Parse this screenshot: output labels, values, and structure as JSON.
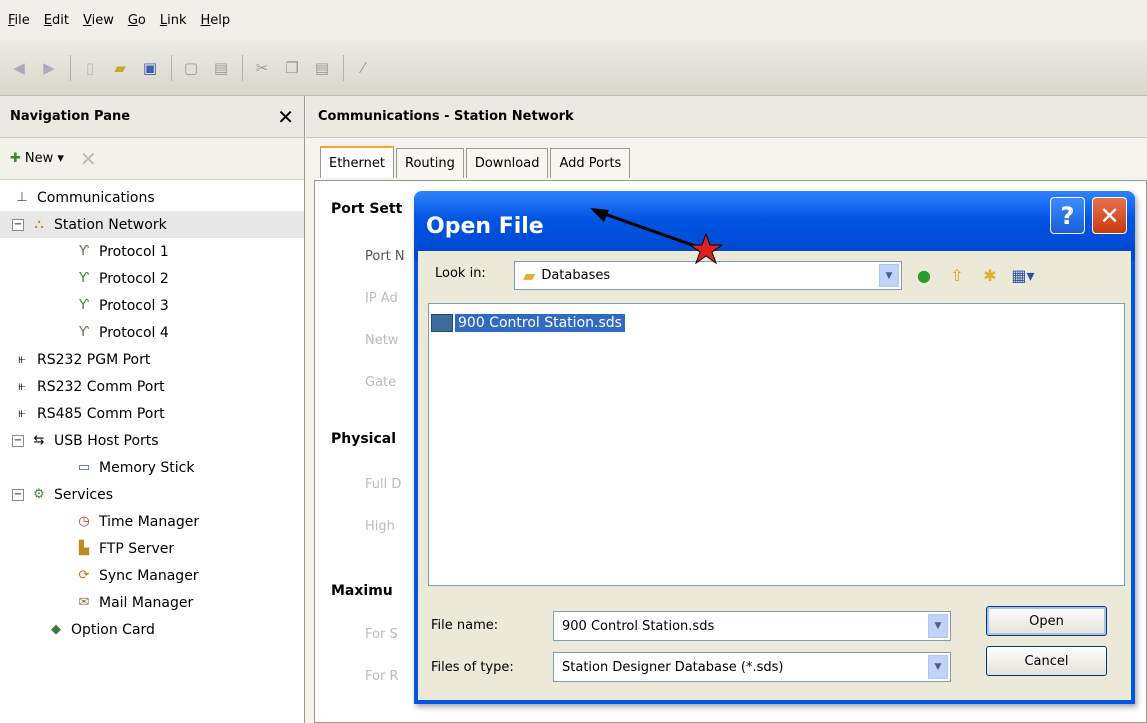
{
  "menu": [
    "File",
    "Edit",
    "View",
    "Go",
    "Link",
    "Help"
  ],
  "nav": {
    "title": "Navigation Pane",
    "close": "✕",
    "new_label": "New ▾",
    "tree": [
      {
        "label": "Communications",
        "icon": "antenna-icon"
      },
      {
        "label": "Station Network",
        "icon": "network-icon"
      },
      {
        "label": "Protocol 1",
        "icon": "protocol-icon"
      },
      {
        "label": "Protocol 2",
        "icon": "protocol-icon"
      },
      {
        "label": "Protocol 3",
        "icon": "protocol-icon"
      },
      {
        "label": "Protocol 4",
        "icon": "protocol-icon"
      },
      {
        "label": "RS232 PGM Port",
        "icon": "serial-port-icon"
      },
      {
        "label": "RS232 Comm Port",
        "icon": "serial-port-icon"
      },
      {
        "label": "RS485 Comm Port",
        "icon": "serial-port-icon"
      },
      {
        "label": "USB Host Ports",
        "icon": "usb-icon"
      },
      {
        "label": "Memory Stick",
        "icon": "memory-stick-icon"
      },
      {
        "label": "Services",
        "icon": "services-icon"
      },
      {
        "label": "Time Manager",
        "icon": "clock-icon"
      },
      {
        "label": "FTP Server",
        "icon": "ftp-icon"
      },
      {
        "label": "Sync Manager",
        "icon": "sync-icon"
      },
      {
        "label": "Mail Manager",
        "icon": "mail-icon"
      },
      {
        "label": "Option Card",
        "icon": "card-icon"
      }
    ]
  },
  "main": {
    "title": "Communications - Station Network",
    "tabs": [
      "Ethernet",
      "Routing",
      "Download",
      "Add Ports"
    ],
    "sections": {
      "port": "Port Sett",
      "physical": "Physical",
      "maximum": "Maximu"
    },
    "labels": {
      "port_name": "Port N",
      "ip": "IP Ad",
      "network": "Netw",
      "gateway": "Gate",
      "full": "Full D",
      "high": "High",
      "for_s": "For S",
      "for_r": "For R"
    }
  },
  "dialog": {
    "title": "Open File",
    "help": "?",
    "close": "✕",
    "look_in_label": "Look in:",
    "look_in_value": "Databases",
    "file": "900 Control Station.sds",
    "file_name_label": "File name:",
    "file_name_value": "900 Control Station.sds",
    "files_of_type_label": "Files of type:",
    "files_of_type_value": "Station Designer Database (*.sds)",
    "open": "Open",
    "cancel": "Cancel"
  },
  "colors": {
    "accent": "#0055e5",
    "selection": "#316ac5",
    "annotation": "#e02020"
  }
}
